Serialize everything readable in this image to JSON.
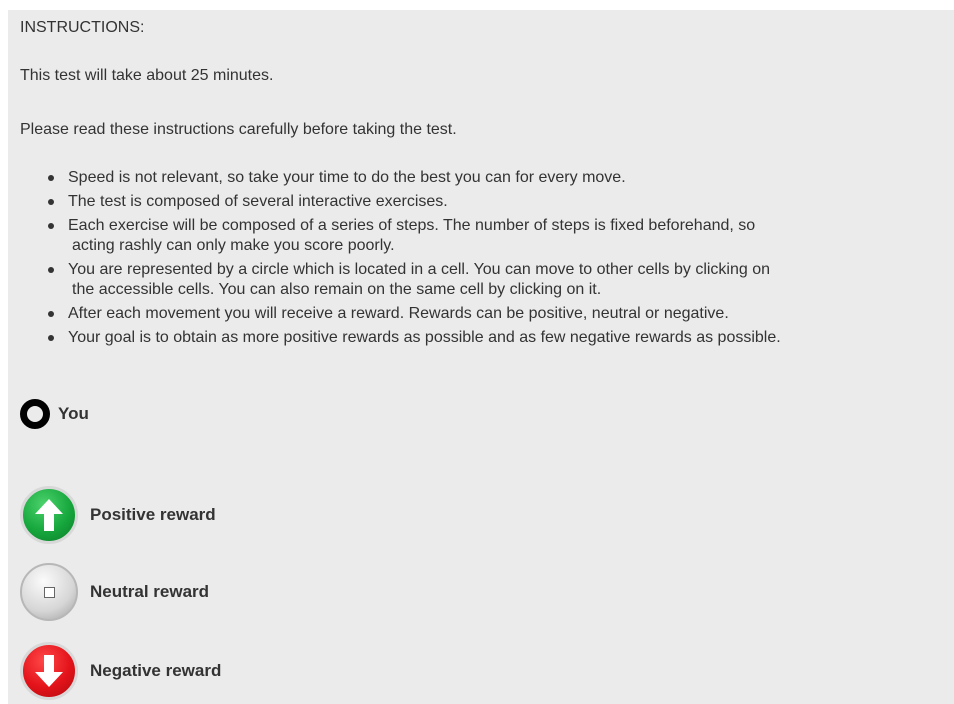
{
  "instructions": {
    "heading": "INSTRUCTIONS:",
    "duration": "This test will take about 25 minutes.",
    "intro": "Please read these instructions carefully before taking the test.",
    "rules": [
      {
        "line1": "Speed is not relevant, so take your time to do the best you can for every move.",
        "line2": ""
      },
      {
        "line1": "The test is composed of several interactive exercises.",
        "line2": ""
      },
      {
        "line1": "Each exercise will be composed of a series of steps. The number of steps is fixed beforehand, so",
        "line2": "acting rashly can only make you score poorly."
      },
      {
        "line1": "You are represented by a circle which is located in a cell. You can move to other cells by clicking on",
        "line2": "the accessible cells. You can also remain on the same cell by clicking on it."
      },
      {
        "line1": "After each movement you will receive a reward. Rewards can be positive, neutral or negative.",
        "line2": ""
      },
      {
        "line1": "Your goal is to obtain as more positive rewards as possible and as few negative rewards as possible.",
        "line2": ""
      }
    ]
  },
  "legend": {
    "you": {
      "label": "You",
      "icon": "ring-icon"
    },
    "positive": {
      "label": "Positive reward",
      "icon": "arrow-up-icon",
      "color": "#16a73d"
    },
    "neutral": {
      "label": "Neutral reward",
      "icon": "square-icon",
      "color": "#d6d6d6"
    },
    "negative": {
      "label": "Negative reward",
      "icon": "arrow-down-icon",
      "color": "#e3131a"
    }
  }
}
